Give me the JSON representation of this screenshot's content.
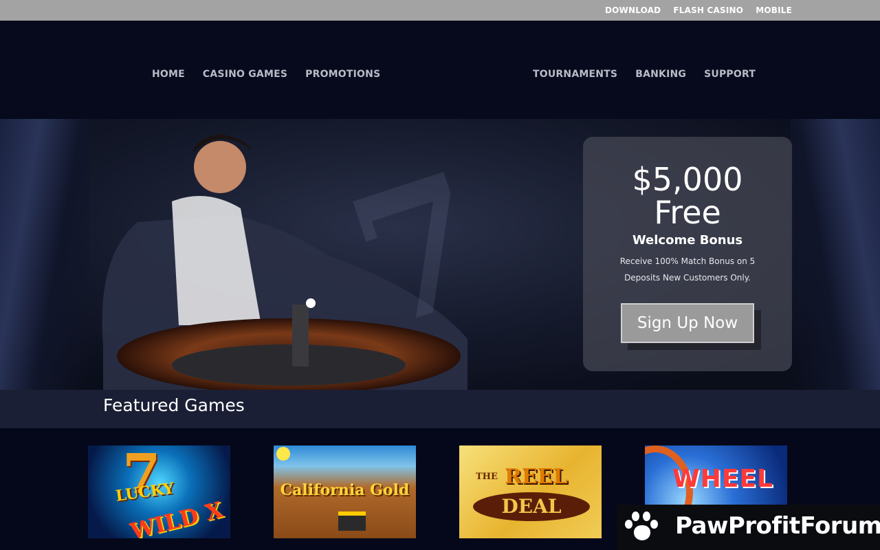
{
  "topbar": {
    "links": [
      "DOWNLOAD",
      "FLASH CASINO",
      "MOBILE"
    ]
  },
  "nav": {
    "left": [
      "HOME",
      "CASINO GAMES",
      "PROMOTIONS"
    ],
    "right": [
      "TOURNAMENTS",
      "BANKING",
      "SUPPORT"
    ]
  },
  "promo": {
    "amount": "$5,000",
    "free": "Free",
    "welcome": "Welcome Bonus",
    "description": "Receive 100% Match Bonus on 5 Deposits New Customers Only.",
    "cta": "Sign Up Now"
  },
  "featured": {
    "title": "Featured Games",
    "games": [
      {
        "name": "Lucky 7's Wild X"
      },
      {
        "name": "California Gold"
      },
      {
        "name": "The Reel Deal"
      },
      {
        "name": "Wheel"
      }
    ]
  },
  "watermark": {
    "text": "PawProfitForum"
  },
  "colors": {
    "topbar": "#a3a3a3",
    "header": "#070a1c",
    "featured_bar": "#1b1f35",
    "cta": "#9a9a9a"
  }
}
